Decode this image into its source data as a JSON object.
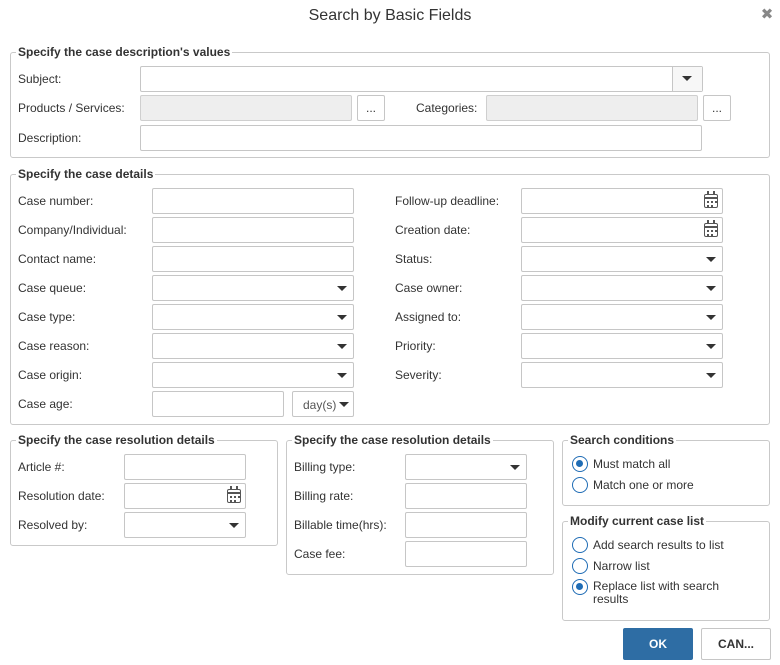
{
  "dialog": {
    "title": "Search by Basic Fields",
    "close_glyph": "✖"
  },
  "description_section": {
    "legend": "Specify the case description's values",
    "subject_label": "Subject:",
    "products_label": "Products / Services:",
    "categories_label": "Categories:",
    "description_label": "Description:",
    "ellipsis": "..."
  },
  "details_section": {
    "legend": "Specify the case details",
    "case_number_label": "Case number:",
    "company_label": "Company/Individual:",
    "contact_label": "Contact name:",
    "case_queue_label": "Case queue:",
    "case_type_label": "Case type:",
    "case_reason_label": "Case reason:",
    "case_origin_label": "Case origin:",
    "case_age_label": "Case age:",
    "case_age_unit": "day(s)",
    "followup_label": "Follow-up deadline:",
    "creation_label": "Creation date:",
    "status_label": "Status:",
    "owner_label": "Case owner:",
    "assigned_label": "Assigned to:",
    "priority_label": "Priority:",
    "severity_label": "Severity:"
  },
  "resolution_section": {
    "legend": "Specify the case resolution details",
    "article_label": "Article #:",
    "resolution_date_label": "Resolution date:",
    "resolved_by_label": "Resolved by:"
  },
  "billing_section": {
    "legend": "Specify the case resolution details",
    "billing_type_label": "Billing type:",
    "billing_rate_label": "Billing rate:",
    "billable_time_label": "Billable time(hrs):",
    "case_fee_label": "Case fee:"
  },
  "search_conditions": {
    "legend": "Search conditions",
    "options": [
      "Must match all",
      "Match one or more"
    ],
    "selected": "Must match all"
  },
  "modify_list": {
    "legend": "Modify current case list",
    "options": [
      "Add search results to list",
      "Narrow list",
      "Replace list with search results"
    ],
    "selected": "Replace list with search results"
  },
  "buttons": {
    "ok": "OK",
    "cancel": "CAN..."
  },
  "colors": {
    "primary": "#2e6da4",
    "radio": "#1f6cb5",
    "border": "#c9c9c9"
  }
}
